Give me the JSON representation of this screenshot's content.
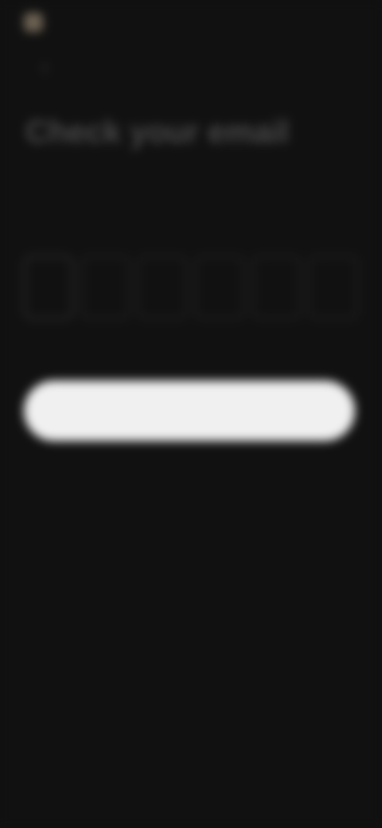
{
  "header": {
    "brand_name": "",
    "back_icon": "chevron-left-icon"
  },
  "main": {
    "title": "Check your email",
    "subtitle": "",
    "email": ""
  },
  "code": {
    "digits": [
      "",
      "",
      "",
      "",
      "",
      ""
    ]
  },
  "actions": {
    "primary_label": "",
    "secondary_label": ""
  }
}
